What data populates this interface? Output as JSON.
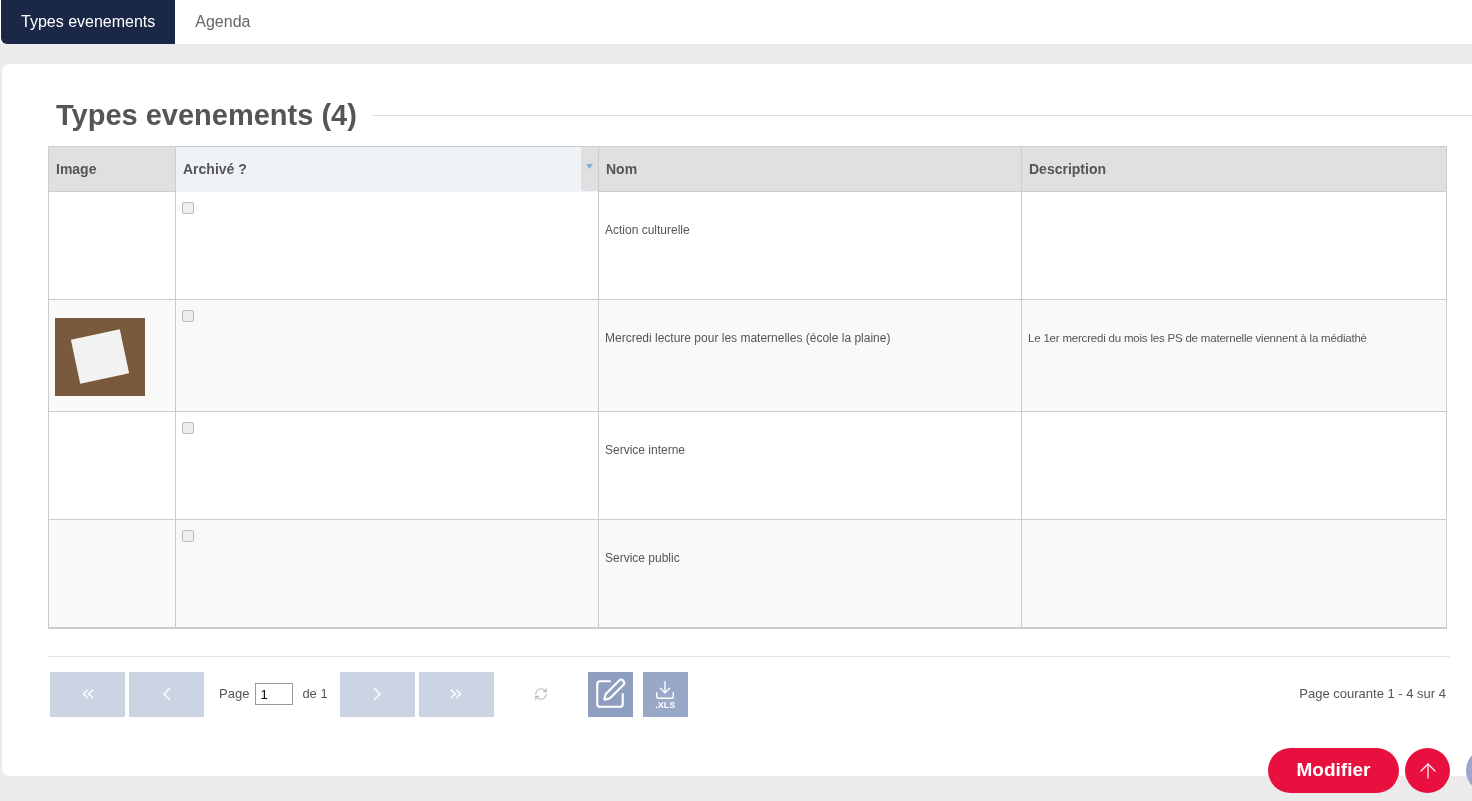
{
  "tabs": [
    {
      "label": "Types evenements",
      "selected": true
    },
    {
      "label": "Agenda",
      "selected": false
    }
  ],
  "title": "Types evenements (4)",
  "table": {
    "columns": [
      {
        "label": "Image",
        "sorted": false
      },
      {
        "label": "Archivé ?",
        "sorted": true
      },
      {
        "label": "Nom",
        "sorted": false
      },
      {
        "label": "Description",
        "sorted": false
      }
    ],
    "rows": [
      {
        "has_photo": false,
        "archived": false,
        "name": "Action culturelle",
        "description": ""
      },
      {
        "has_photo": true,
        "archived": false,
        "name": "Mercredi lecture pour les maternelles (école la plaine)",
        "description": "Le 1er mercredi du mois les PS de maternelle viennent à la médiathè"
      },
      {
        "has_photo": false,
        "archived": false,
        "name": "Service interne",
        "description": ""
      },
      {
        "has_photo": false,
        "archived": false,
        "name": "Service public",
        "description": ""
      }
    ]
  },
  "pager": {
    "page_label": "Page",
    "page_value": "1",
    "of_label": "de 1",
    "summary": "Page courante 1 - 4 sur 4",
    "xls_label": ".XLS"
  },
  "actions": {
    "modify": "Modifier"
  }
}
